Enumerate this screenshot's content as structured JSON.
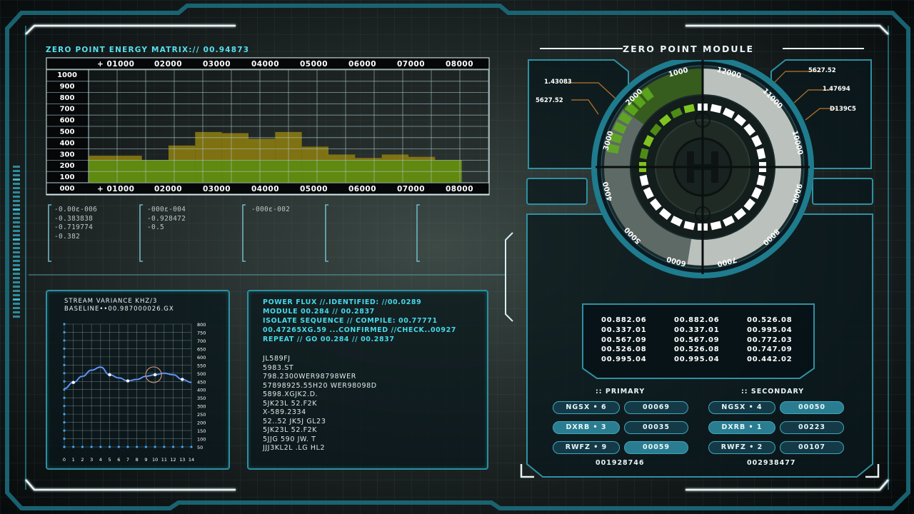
{
  "matrix": {
    "title": "ZERO POINT ENERGY MATRIX:// 00.94873",
    "x_ticks": [
      "+ 01000",
      "02000",
      "03000",
      "04000",
      "05000",
      "06000",
      "07000",
      "08000"
    ],
    "y_ticks": [
      "1000",
      "900",
      "800",
      "700",
      "600",
      "500",
      "400",
      "300",
      "200",
      "100",
      "000"
    ]
  },
  "chart_data": [
    {
      "type": "bar",
      "title": "ZERO POINT ENERGY MATRIX:// 00.94873",
      "categories": [
        "01000",
        "",
        "02000",
        "",
        "03000",
        "",
        "04000",
        "",
        "05000",
        "",
        "06000",
        "",
        "07000",
        "",
        "08000"
      ],
      "series": [
        {
          "values": [
            240,
            240,
            200,
            330,
            450,
            440,
            390,
            450,
            320,
            250,
            220,
            250,
            230,
            200,
            0
          ]
        }
      ],
      "ylim": [
        0,
        1000
      ]
    },
    {
      "type": "line",
      "title": "STREAM VARIANCE KHZ/3",
      "x": [
        0,
        1,
        2,
        3,
        4,
        5,
        6,
        7,
        8,
        9,
        10,
        11,
        12,
        13,
        14
      ],
      "series": [
        {
          "values": [
            380,
            420,
            460,
            500,
            520,
            470,
            450,
            430,
            440,
            460,
            470,
            480,
            470,
            440,
            420
          ]
        }
      ],
      "ylim": [
        0,
        800
      ],
      "x_ticks": [
        "0",
        "1",
        "2",
        "3",
        "4",
        "5",
        "6",
        "7",
        "8",
        "9",
        "10",
        "11",
        "12",
        "13",
        "14"
      ],
      "y_ticks": [
        "800",
        "750",
        "700",
        "650",
        "600",
        "550",
        "500",
        "450",
        "400",
        "350",
        "300",
        "250",
        "200",
        "150",
        "100",
        "50"
      ]
    }
  ],
  "readouts": [
    [
      "-0.00ε-006",
      "-0.383838",
      "-0.719774",
      "-0.382"
    ],
    [
      "-000ε-004",
      "-0.928472",
      "-0.5"
    ],
    [
      "-000ε-002"
    ],
    [],
    []
  ],
  "stream": {
    "title": "STREAM VARIANCE KHZ/3",
    "baseline": "BASELINE••00.987000026.GX"
  },
  "flux": {
    "lines": [
      "POWER FLUX  //.IDENTIFIED: //00.0289",
      "MODULE 00.284 // 00.2837",
      "ISOLATE SEQUENCE // COMPILE: 00.77771",
      "00.47265XG.59 ...CONFIRMED //CHECK..00927",
      "REPEAT // GO 00.284 // 00.2837"
    ],
    "code": [
      "JL589FJ",
      "5983.ST",
      "798.2300WER98798WER",
      "57898925.55H20 WER98098D",
      "5898.XGJK2.D.",
      "5JK23L 52.F2K",
      "X-589.2334",
      "52..52 JK5J GL23",
      "5JK23L 52.F2K",
      "5JJG 590 JW. T",
      "JJJ3KL2L .LG HL2"
    ]
  },
  "module": {
    "title": "ZERO POINT MODULE",
    "left_callouts": [
      "1.43083",
      "5627.52"
    ],
    "right_callouts": [
      "5627.52",
      "1.47694",
      "D139C5"
    ],
    "dial_ticks": [
      "1000",
      "2000",
      "3000",
      "4000",
      "5000",
      "6000",
      "7000",
      "8000",
      "9000",
      "10000",
      "11000",
      "12000"
    ],
    "table": [
      [
        "00.882.06",
        "00.882.06",
        "00.526.08"
      ],
      [
        "00.337.01",
        "00.337.01",
        "00.995.04"
      ],
      [
        "00.567.09",
        "00.567.09",
        "00.772.03"
      ],
      [
        "00.526.08",
        "00.526.08",
        "00.747.09"
      ],
      [
        "00.995.04",
        "00.995.04",
        "00.442.02"
      ]
    ],
    "primary": {
      "header": ":: PRIMARY",
      "rows": [
        {
          "label": "NGSX • 6",
          "value": "00069"
        },
        {
          "label": "DXRB • 3",
          "value": "00035"
        },
        {
          "label": "RWFZ • 9",
          "value": "00059"
        }
      ],
      "total": "001928746"
    },
    "secondary": {
      "header": ":: SECONDARY",
      "rows": [
        {
          "label": "NGSX • 4",
          "value": "00050"
        },
        {
          "label": "DXRB • 1",
          "value": "00223"
        },
        {
          "label": "RWFZ • 2",
          "value": "00107"
        }
      ],
      "total": "002938477"
    }
  },
  "colors": {
    "accent": "#46d6e6",
    "frame": "#1f7c8e",
    "bar_high": "#8a7a10",
    "bar_low": "#5f8a10",
    "dial_green": "#5fae1c"
  }
}
